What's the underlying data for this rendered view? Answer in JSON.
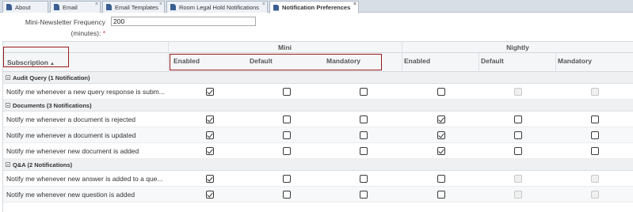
{
  "tabs": [
    {
      "label": "About",
      "active": false
    },
    {
      "label": "Email",
      "active": false
    },
    {
      "label": "Email Templates",
      "active": false
    },
    {
      "label": "Room Legal Hold Notifications",
      "active": false
    },
    {
      "label": "Notification Preferences",
      "active": true
    }
  ],
  "close_glyph": "×",
  "frequency": {
    "label_line1": "Mini-Newsletter Frequency",
    "label_line2": "(minutes):",
    "required_mark": "*",
    "value": "200"
  },
  "grid": {
    "groups": {
      "mini": "Mini",
      "nightly": "Nightly"
    },
    "columns": {
      "subscription": "Subscription",
      "sort_glyph": "▲",
      "mini_enabled": "Enabled",
      "mini_default": "Default",
      "mini_mandatory": "Mandatory",
      "nightly_enabled": "Enabled",
      "nightly_default": "Default",
      "nightly_mandatory": "Mandatory"
    },
    "sections": [
      {
        "title": "Audit Query (1 Notification)",
        "rows": [
          {
            "label": "Notify me whenever a new query response is subm...",
            "checks": [
              true,
              false,
              false,
              false,
              false,
              false
            ],
            "disabled": [
              false,
              false,
              false,
              false,
              true,
              true
            ]
          }
        ]
      },
      {
        "title": "Documents (3 Notifications)",
        "rows": [
          {
            "label": "Notify me whenever a document is rejected",
            "checks": [
              true,
              false,
              false,
              true,
              false,
              false
            ],
            "disabled": [
              false,
              false,
              false,
              false,
              false,
              false
            ]
          },
          {
            "label": "Notify me whenever a document is updated",
            "checks": [
              true,
              false,
              false,
              true,
              false,
              false
            ],
            "disabled": [
              false,
              false,
              false,
              false,
              false,
              false
            ]
          },
          {
            "label": "Notify me whenever new document is added",
            "checks": [
              true,
              false,
              false,
              true,
              false,
              false
            ],
            "disabled": [
              false,
              false,
              false,
              false,
              false,
              false
            ]
          }
        ]
      },
      {
        "title": "Q&A (2 Notifications)",
        "rows": [
          {
            "label": "Notify me whenever new answer is added to a que...",
            "checks": [
              true,
              false,
              false,
              false,
              false,
              false
            ],
            "disabled": [
              false,
              false,
              false,
              false,
              true,
              true
            ]
          },
          {
            "label": "Notify me whenever new question is added",
            "checks": [
              true,
              false,
              false,
              false,
              false,
              false
            ],
            "disabled": [
              false,
              false,
              false,
              false,
              true,
              true
            ]
          }
        ]
      }
    ]
  }
}
